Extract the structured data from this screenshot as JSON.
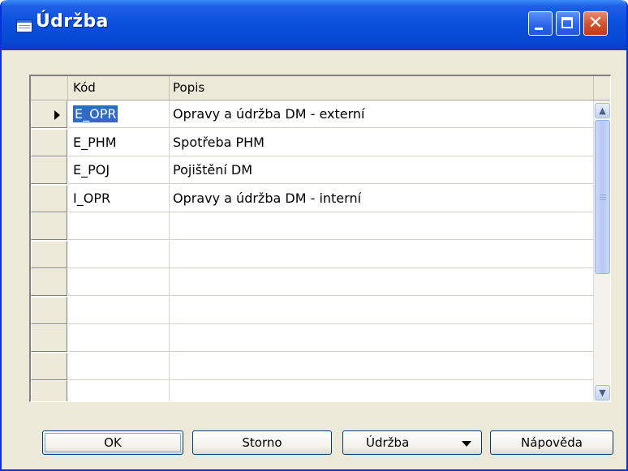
{
  "window": {
    "title": "Údržba",
    "icon": "table-icon",
    "controls": [
      "minimize",
      "maximize",
      "close"
    ],
    "close_glyph": "✕"
  },
  "grid": {
    "columns": [
      "Kód",
      "Popis"
    ],
    "rows": [
      {
        "code": "E_OPR",
        "description": "Opravy a údržba DM - externí",
        "current": true
      },
      {
        "code": "E_PHM",
        "description": "Spotřeba PHM"
      },
      {
        "code": "E_POJ",
        "description": "Pojištění DM"
      },
      {
        "code": "I_OPR",
        "description": "Opravy a údržba DM - interní"
      }
    ],
    "empty_row_count": 7
  },
  "buttons": {
    "ok": "OK",
    "storno": "Storno",
    "udrzba": "Údržba",
    "napoveda": "Nápověda"
  },
  "colors": {
    "titlebar": "#0a50dc",
    "selection": "#316ac5",
    "dialog_bg": "#ece9d8"
  }
}
